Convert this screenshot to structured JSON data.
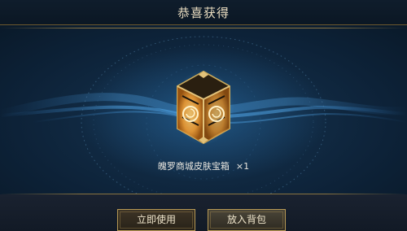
{
  "dialog": {
    "title": "恭喜获得"
  },
  "reward": {
    "item_name": "魄罗商城皮肤宝箱",
    "quantity": "×1",
    "icon": "skin-chest-icon"
  },
  "buttons": {
    "use_now": "立即使用",
    "put_in_bag": "放入背包"
  },
  "colors": {
    "gold_accent": "#c9a95c",
    "glow_blue": "#3fa3ff",
    "chest_orange": "#f2a13a"
  }
}
